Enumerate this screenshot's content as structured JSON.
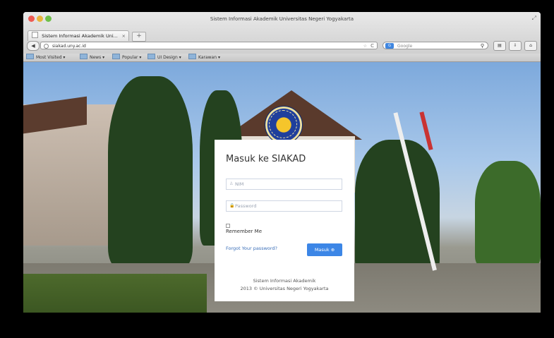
{
  "window": {
    "title": "Sistem Informasi Akademik Universitas Negeri Yogyakarta",
    "tab_label": "Sistem Informasi Akademik Uni...",
    "tab_close": "×",
    "new_tab": "+"
  },
  "navbar": {
    "back": "◀",
    "url": "siakad.uny.ac.id",
    "reload": "C",
    "url_star": "☆",
    "search_engine": "G",
    "search_placeholder": "Google",
    "search_icon": "⚲",
    "btn_bookmarks": "▤",
    "btn_download": "⇩",
    "btn_home": "⌂"
  },
  "bookmarks": {
    "items": [
      "Most Visited ▾",
      "News ▾",
      "Popular ▾",
      "UI Design ▾",
      "Karawan ▾"
    ]
  },
  "login": {
    "title": "Masuk ke SIAKAD",
    "nim_placeholder": "NIM",
    "password_placeholder": "Password",
    "remember_label": "Remember Me",
    "forgot_link": "Forgot Your password?",
    "submit_label": "Masuk ⊕",
    "user_icon": "♙",
    "lock_icon": "🔒",
    "footer_line1": "Sistem Informasi Akademik",
    "footer_line2": "2013 © Universitas Negeri Yogyakarta"
  },
  "colors": {
    "accent": "#3c86e6",
    "link": "#3b6fb8"
  }
}
